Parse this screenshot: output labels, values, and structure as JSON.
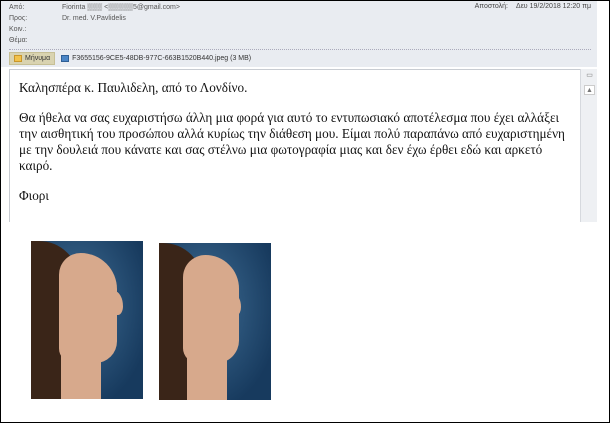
{
  "header": {
    "from_label": "Από:",
    "from_value": "Fiorinta ▒▒▒ <▒▒▒▒▒5@gmail.com>",
    "to_label": "Προς:",
    "to_value": "Dr. med. V.Pavlidelis",
    "cc_label": "Κοιν.:",
    "subject_label": "Θέμα:",
    "sent_label": "Αποστολή:",
    "sent_value": "Δευ 19/2/2018 12:20 πμ"
  },
  "attachments": {
    "message_tab": "Μήνυμα",
    "file": "F3655156-9CE5-48DB-977C-663B1520B440.jpeg (3 MB)"
  },
  "message": {
    "greeting": "Καλησπέρα κ. Παυλιδελη, από το Λονδίνο.",
    "paragraph": "Θα ήθελα να σας ευχαριστήσω άλλη μια φορά για αυτό το εντυπωσιακό αποτέλεσμα που έχει αλλάξει την αισθητική του προσώπου αλλά κυρίως την διάθεση μου. Είμαι πολύ παραπάνω από ευχαριστημένη με την δουλειά που κάνατε και σας στέλνω μια φωτογραφία μιας και δεν έχω έρθει εδώ και αρκετό καιρό.",
    "signature": "Φιορι"
  },
  "colors": {
    "header_bg": "#e9ecf1",
    "photo_bg": "#1f4770"
  }
}
